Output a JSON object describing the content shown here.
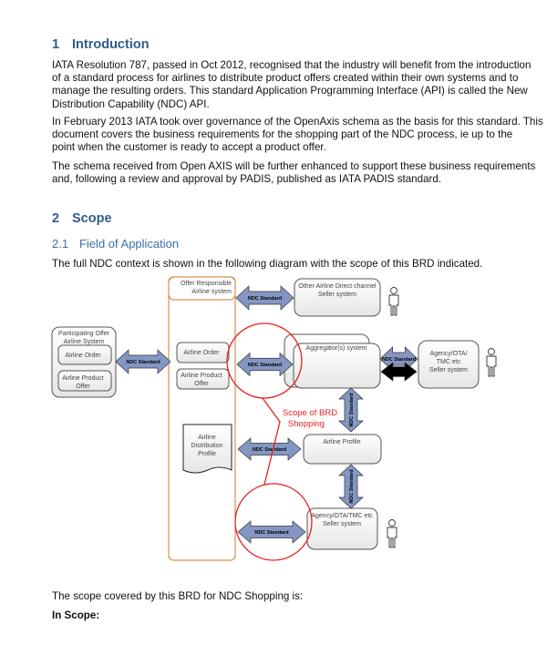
{
  "section1": {
    "number": "1",
    "title": "Introduction",
    "paragraphs": [
      [
        "IATA Resolution 787, passed in Oct 2012, recognised that  the industry will benefit from the introduction",
        "of a standard process for airlines to distribute product offers created within their own systems and to",
        "manage the resulting orders. This standard Application Programming Interface (API) is called the New",
        "Distribution Capability (NDC) API."
      ],
      [
        "In February 2013 IATA took over governance of the OpenAxis schema as the basis for this standard. This",
        "document covers the business requirements for the shopping part of the NDC process, ie up to the",
        "point when the customer is ready to accept a product offer."
      ],
      [
        "The schema received from Open AXIS will be further enhanced to support these business requirements",
        "and, following a review and approval by PADIS, published as IATA PADIS standard."
      ]
    ]
  },
  "section2": {
    "number": "2",
    "title": "Scope",
    "sub": {
      "number": "2.1",
      "title": "Field of Application"
    },
    "intro": "The full NDC context is shown in the following diagram with the scope of this BRD indicated.",
    "scope_text": "The scope covered by this BRD for NDC Shopping is:",
    "in_scope": "In Scope:"
  },
  "diagram": {
    "participating": [
      "Participating Offer",
      "Airline System"
    ],
    "p_order": "Airline Order",
    "p_offer": [
      "Airline Product",
      "Offer"
    ],
    "offer_resp": [
      "Offer Responsible",
      "Airline system"
    ],
    "o_order": "Airline Order",
    "o_offer": [
      "Airline Product",
      "Offer"
    ],
    "adp": [
      "Airline",
      "Distribution",
      "Profile"
    ],
    "other_airline": [
      "Other Airline Direct channel",
      "Seller system"
    ],
    "aggregator": "Aggregator(s) system",
    "agency_right": [
      "Agency/OTA/",
      "TMC etc",
      "Seller system"
    ],
    "airline_profile": "Airline Profile",
    "agency_bottom": [
      "Agency/OTA/TMC etc",
      "Seller system"
    ],
    "ndc": "NDC Standard",
    "proprietary": "Proprietary",
    "scope": [
      "Scope of BRD",
      "Shopping"
    ],
    "colors": {
      "arrow": "#8497c4",
      "orange": "#d07a2a",
      "red": "#e82020",
      "heading": "#2f5c8e"
    }
  }
}
